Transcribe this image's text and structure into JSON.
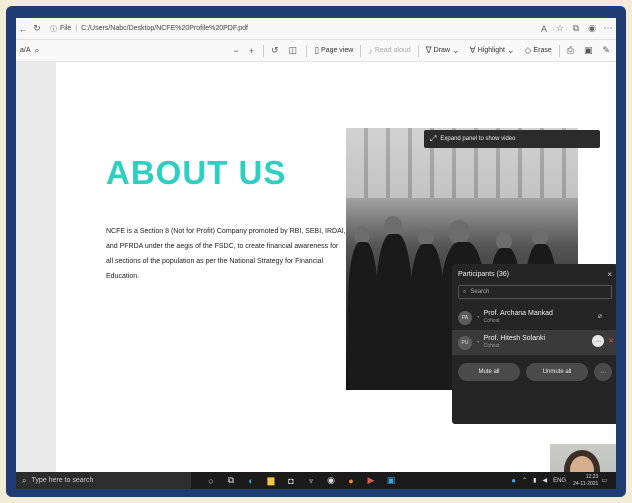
{
  "browser": {
    "info_label": "File",
    "url": "C:/Users/Nabc/Desktop/NCFE%20Profile%20PDF.pdf"
  },
  "pdf_toolbar": {
    "search_label": "a/A",
    "page_view_label": "Page view",
    "read_aloud_label": "Read aloud",
    "draw_label": "Draw",
    "highlight_label": "Highlight",
    "erase_label": "Erase"
  },
  "document": {
    "title": "ABOUT US",
    "body": "NCFE is a Section 8 (Not for Profit) Company promoted by RBI, SEBI, IRDAI, and PFRDA under the aegis of the FSDC, to create financial awareness for all sections of the population as per the National Strategy for Financial Education."
  },
  "meeting": {
    "expand_hint": "Expand panel to show video",
    "participants_title": "Participants (36)",
    "search_placeholder": "Search",
    "participants": [
      {
        "initials": "PA",
        "name": "Prof. Archana Mankad",
        "role": "Cohost"
      },
      {
        "initials": "PU",
        "name": "Prof. Hitesh Solanki",
        "role": "Cohost"
      }
    ],
    "mute_all_label": "Mute all",
    "unmute_all_label": "Unmute all"
  },
  "taskbar": {
    "search_placeholder": "Type here to search",
    "language": "ENG",
    "time": "12:23",
    "date": "24-11-2021"
  },
  "colors": {
    "accent": "#2ccfc0",
    "frame": "#1f3c73",
    "panel": "#252526"
  }
}
